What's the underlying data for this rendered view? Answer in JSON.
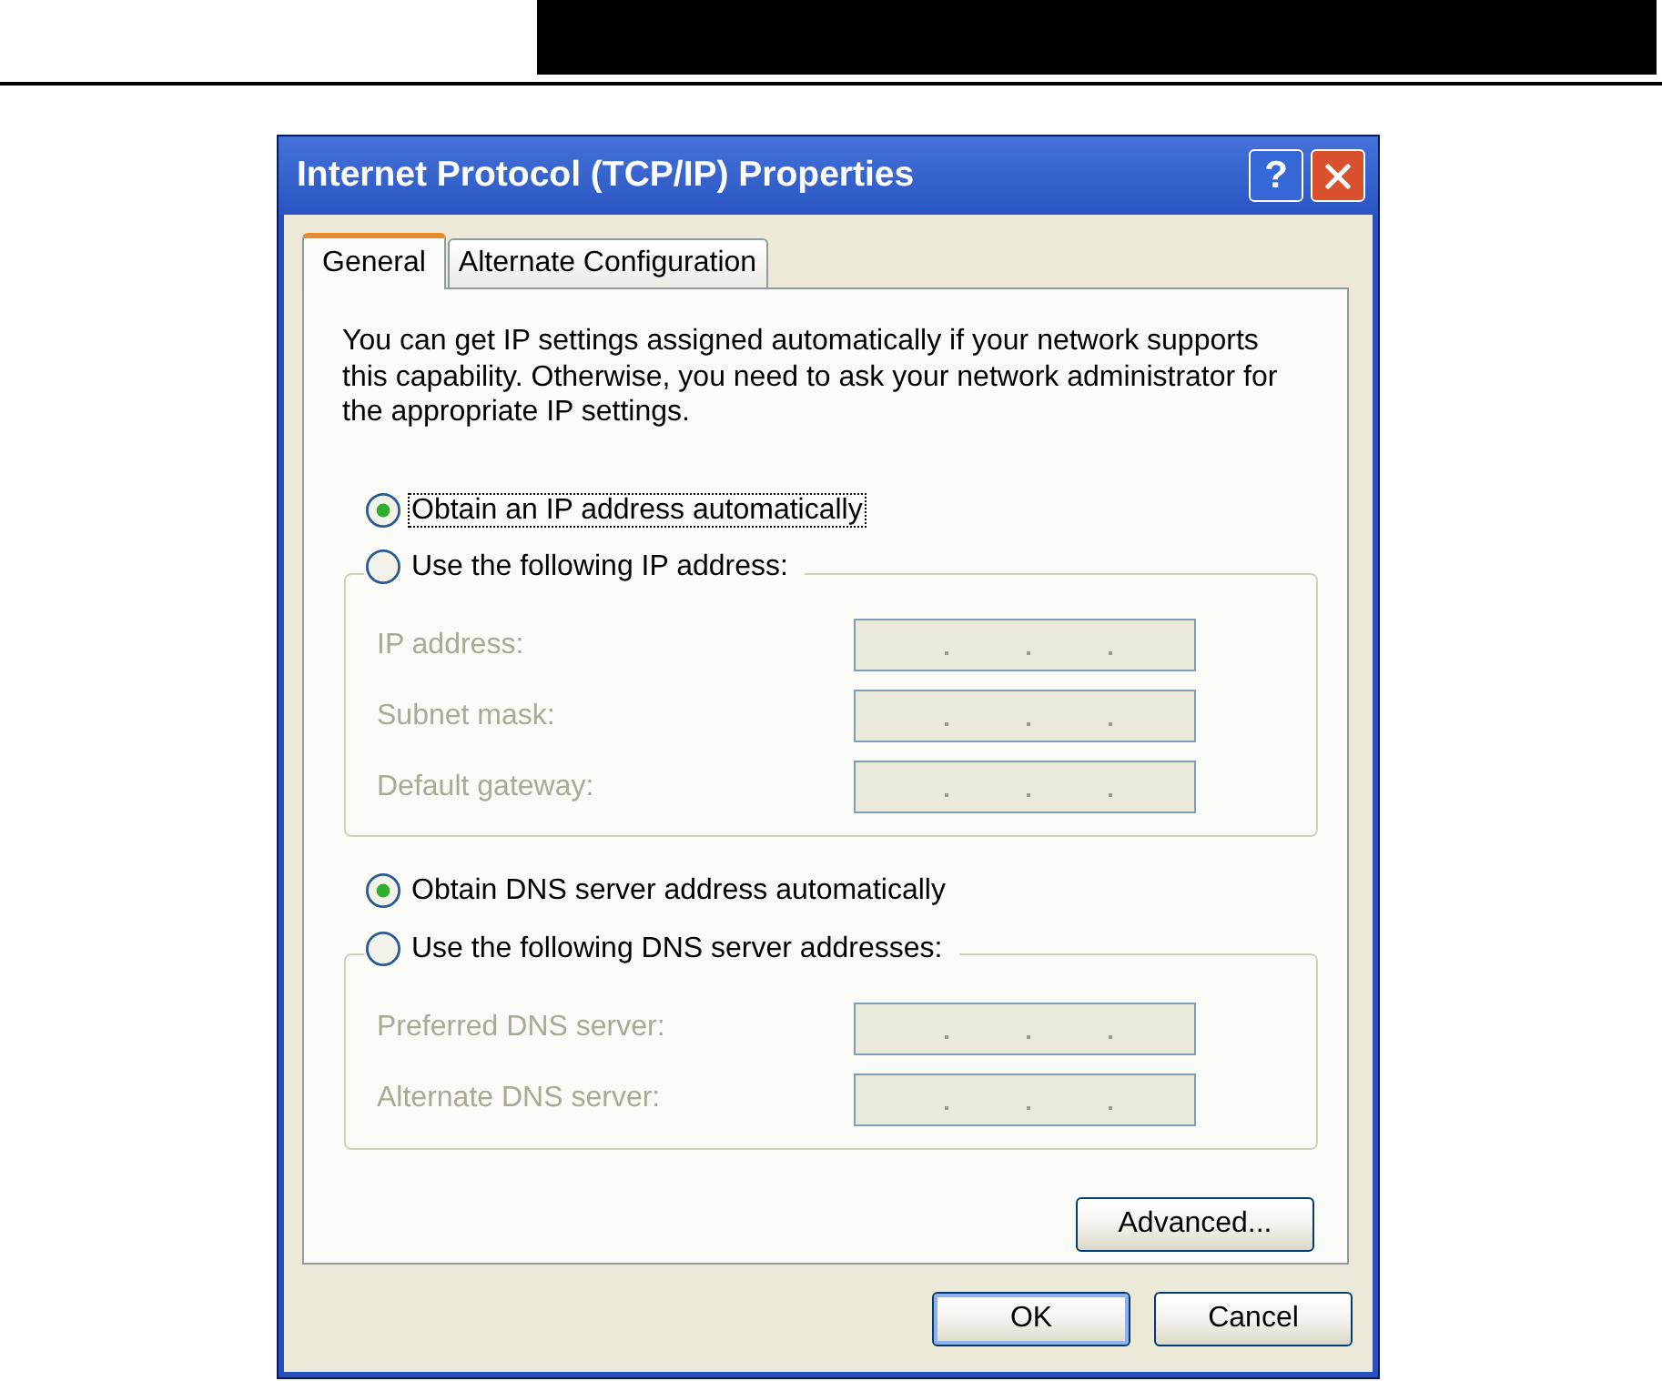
{
  "window": {
    "title": "Internet Protocol (TCP/IP) Properties",
    "help_button": "?"
  },
  "tabs": [
    {
      "label": "General",
      "selected": true
    },
    {
      "label": "Alternate Configuration",
      "selected": false
    }
  ],
  "description": "You can get IP settings assigned automatically if your network supports this capability. Otherwise, you need to ask your network administrator for the appropriate IP settings.",
  "ip_address": {
    "options": [
      {
        "label": "Obtain an IP address automatically",
        "selected": true,
        "focused": true
      },
      {
        "label": "Use the following IP address:",
        "selected": false,
        "focused": false
      }
    ],
    "fields": [
      {
        "label": "IP address:",
        "disabled": true
      },
      {
        "label": "Subnet mask:",
        "disabled": true
      },
      {
        "label": "Default gateway:",
        "disabled": true
      }
    ]
  },
  "dns_server": {
    "options": [
      {
        "label": "Obtain DNS server address automatically",
        "selected": true,
        "focused": false
      },
      {
        "label": "Use the following DNS server addresses:",
        "selected": false,
        "focused": false
      }
    ],
    "fields": [
      {
        "label": "Preferred DNS server:",
        "disabled": true
      },
      {
        "label": "Alternate DNS server:",
        "disabled": true
      }
    ]
  },
  "advanced_button": {
    "label": "Advanced..."
  },
  "buttons": [
    {
      "label": "OK",
      "default": true
    },
    {
      "label": "Cancel",
      "default": false
    }
  ]
}
